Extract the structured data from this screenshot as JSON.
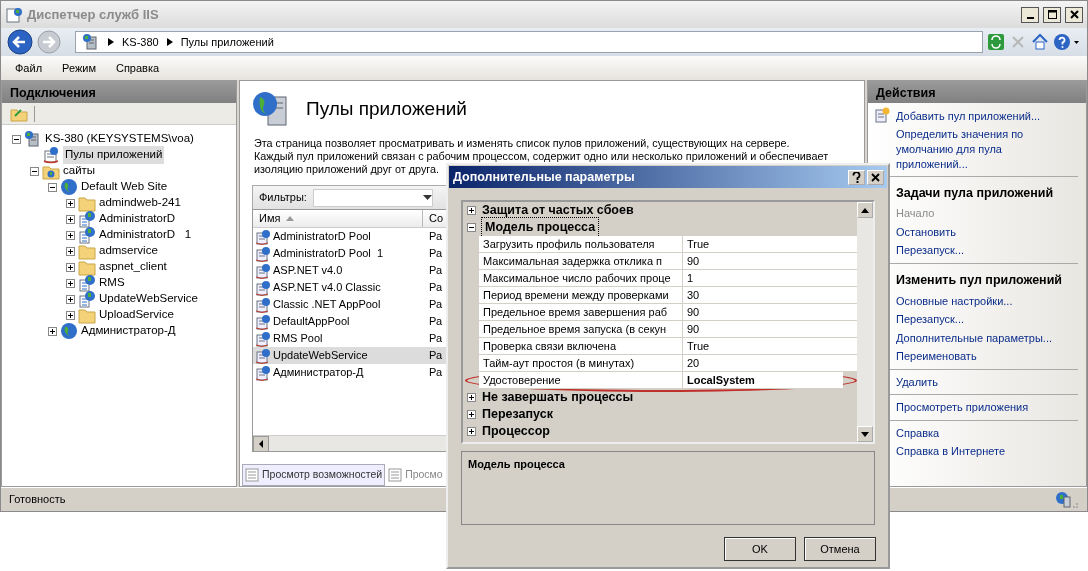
{
  "window": {
    "title": "Диспетчер служб IIS"
  },
  "breadcrumb": [
    "KS-380",
    "Пулы приложений"
  ],
  "menu": [
    "Файл",
    "Режим",
    "Справка"
  ],
  "connections": {
    "title": "Подключения",
    "tree": [
      {
        "label": "KS-380 (KEYSYSTEMS\\voa)",
        "kind": "server",
        "expanded": true,
        "selected": false,
        "children": [
          {
            "label": "Пулы приложений",
            "kind": "pools",
            "selected": true
          },
          {
            "label": "сайты",
            "kind": "sites",
            "expanded": true,
            "selected": false,
            "children": [
              {
                "label": "Default Web Site",
                "kind": "site",
                "expanded": true,
                "selected": false,
                "children": [
                  {
                    "label": "admindweb-241",
                    "kind": "folder",
                    "expanded": false,
                    "selected": false
                  },
                  {
                    "label": "AdministratorD",
                    "kind": "app",
                    "expanded": false,
                    "selected": false
                  },
                  {
                    "label": "AdministratorD   1",
                    "kind": "app",
                    "expanded": false,
                    "selected": false
                  },
                  {
                    "label": "admservice",
                    "kind": "folder",
                    "expanded": false,
                    "selected": false
                  },
                  {
                    "label": "aspnet_client",
                    "kind": "folder",
                    "expanded": false,
                    "selected": false
                  },
                  {
                    "label": "RMS",
                    "kind": "app",
                    "expanded": false,
                    "selected": false
                  },
                  {
                    "label": "UpdateWebService",
                    "kind": "app",
                    "expanded": false,
                    "selected": false
                  },
                  {
                    "label": "UploadService",
                    "kind": "folder",
                    "expanded": false,
                    "selected": false
                  }
                ]
              },
              {
                "label": "Администратор-Д",
                "kind": "site",
                "expanded": false,
                "selected": false
              }
            ]
          }
        ]
      }
    ]
  },
  "pools": {
    "title": "Пулы приложений",
    "description": [
      "Эта страница позволяет просматривать и изменять список пулов приложений, существующих на сервере.",
      "Каждый пул приложений связан с рабочим процессом, содержит одно или несколько приложений и обеспечивает",
      "изоляцию приложений друг от друга."
    ],
    "filter_label": "Фильтры:",
    "columns": [
      "Имя",
      "Со"
    ],
    "rows": [
      {
        "name": "AdministratorD Pool",
        "column_2": "Ра",
        "selected": false
      },
      {
        "name": "AdministratorD Pool  1",
        "column_2": "Ра",
        "selected": false
      },
      {
        "name": "ASP.NET v4.0",
        "column_2": "Ра",
        "selected": false
      },
      {
        "name": "ASP.NET v4.0 Classic",
        "column_2": "Ра",
        "selected": false
      },
      {
        "name": "Classic .NET AppPool",
        "column_2": "Ра",
        "selected": false
      },
      {
        "name": "DefaultAppPool",
        "column_2": "Ра",
        "selected": false
      },
      {
        "name": "RMS Pool",
        "column_2": "Ра",
        "selected": false
      },
      {
        "name": "UpdateWebService",
        "column_2": "Ра",
        "selected": true
      },
      {
        "name": "Администратор-Д",
        "column_2": "Ра",
        "selected": false
      }
    ],
    "view_tabs": [
      {
        "label": "Просмотр возможностей",
        "selected": true
      },
      {
        "label": "Просмо",
        "selected": false
      }
    ]
  },
  "actions": {
    "title": "Действия",
    "groups": [
      {
        "items": [
          {
            "label": "Добавить пул приложений...",
            "disabled": false
          },
          {
            "label": "Определить значения по умолчанию для пула приложений...",
            "disabled": false
          }
        ]
      },
      {
        "heading": "Задачи пула приложений",
        "items": [
          {
            "label": "Начало",
            "disabled": true
          },
          {
            "label": "Остановить",
            "disabled": false
          },
          {
            "label": "Перезапуск...",
            "disabled": false
          }
        ]
      },
      {
        "heading": "Изменить пул приложений",
        "items": [
          {
            "label": "Основные настройки...",
            "disabled": false
          },
          {
            "label": "Перезапуск...",
            "disabled": false
          },
          {
            "label": "Дополнительные параметры...",
            "disabled": false
          },
          {
            "label": "Переименовать",
            "disabled": false
          }
        ]
      },
      {
        "items": [
          {
            "label": "Удалить",
            "disabled": false
          }
        ]
      },
      {
        "items": [
          {
            "label": "Просмотреть приложения",
            "disabled": false
          }
        ]
      },
      {
        "items": [
          {
            "label": "Справка",
            "disabled": false
          },
          {
            "label": "Справка в Интернете",
            "disabled": false
          }
        ]
      }
    ]
  },
  "status_bar": "Готовность",
  "dialog": {
    "title": "Дополнительные параметры",
    "categories": [
      {
        "label": "Защита от частых сбоев",
        "expanded": false,
        "selected": false
      },
      {
        "label": "Модель процесса",
        "expanded": true,
        "selected": true,
        "properties": [
          {
            "name": "Загрузить профиль пользователя",
            "value": "True",
            "modified": false,
            "circled": false
          },
          {
            "name": "Максимальная задержка отклика п",
            "value": "90",
            "modified": false,
            "circled": false
          },
          {
            "name": "Максимальное число рабочих проце",
            "value": "1",
            "modified": false,
            "circled": false
          },
          {
            "name": "Период времени между проверками",
            "value": "30",
            "modified": false,
            "circled": false
          },
          {
            "name": "Предельное время завершения раб",
            "value": "90",
            "modified": false,
            "circled": false
          },
          {
            "name": "Предельное время запуска (в секун",
            "value": "90",
            "modified": false,
            "circled": false
          },
          {
            "name": "Проверка связи включена",
            "value": "True",
            "modified": false,
            "circled": false
          },
          {
            "name": "Тайм-аут простоя (в минутах)",
            "value": "20",
            "modified": false,
            "circled": false
          },
          {
            "name": "Удостоверение",
            "value": "LocalSystem",
            "modified": true,
            "circled": true
          }
        ]
      },
      {
        "label": "Не завершать процессы",
        "expanded": false,
        "selected": false
      },
      {
        "label": "Перезапуск",
        "expanded": false,
        "selected": false
      },
      {
        "label": "Процессор",
        "expanded": false,
        "selected": false
      }
    ],
    "description_title": "Модель процесса",
    "buttons": [
      "OK",
      "Отмена"
    ]
  }
}
